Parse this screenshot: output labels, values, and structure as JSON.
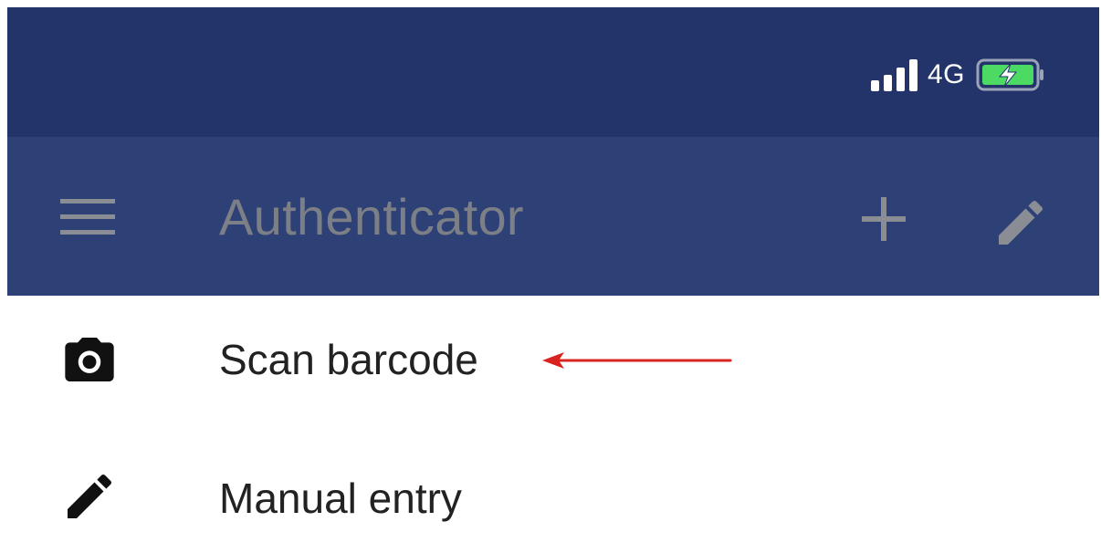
{
  "status_bar": {
    "network_type": "4G",
    "signal_icon": "signal-bars-icon",
    "battery_icon": "battery-charging-icon",
    "battery_color": "#4cd964"
  },
  "app_bar": {
    "title": "Authenticator",
    "menu_icon": "hamburger-menu-icon",
    "add_icon": "plus-icon",
    "edit_icon": "pencil-icon",
    "background_color": "#2d4177"
  },
  "menu": {
    "items": [
      {
        "label": "Scan barcode",
        "icon": "camera-icon"
      },
      {
        "label": "Manual entry",
        "icon": "pencil-icon"
      }
    ]
  },
  "annotation": {
    "arrow_color": "#d9231f"
  }
}
